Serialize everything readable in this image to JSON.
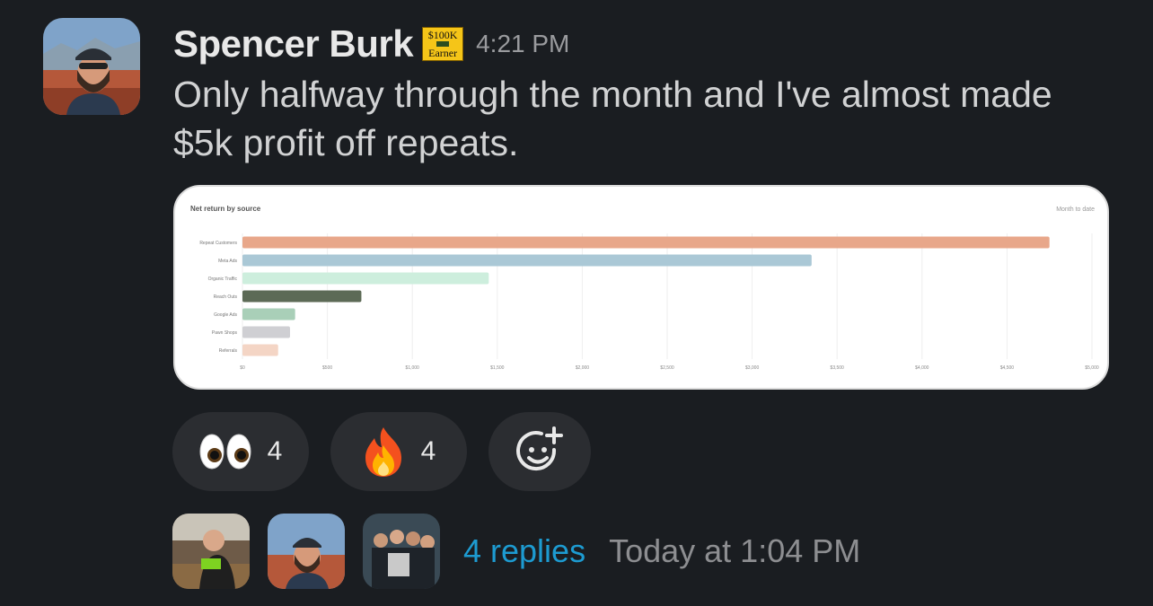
{
  "message": {
    "author": "Spencer Burk",
    "badge": {
      "top": "$100K",
      "bottom": "Earner"
    },
    "time": "4:21 PM",
    "text": "Only halfway through the month and I've almost made $5k profit off repeats."
  },
  "reactions": [
    {
      "emoji": "eyes-icon",
      "count": "4"
    },
    {
      "emoji": "fire-icon",
      "count": "4"
    }
  ],
  "thread": {
    "replies": "4 replies",
    "last_reply": "Today at 1:04 PM"
  },
  "chart_data": {
    "type": "bar",
    "orientation": "horizontal",
    "title": "Net return by source",
    "subtitle": "Month to date",
    "categories": [
      "Repeat Customers",
      "Meta Ads",
      "Organic Traffic",
      "Reach Outs",
      "Google Ads",
      "Pawn Shops",
      "Referrals"
    ],
    "values": [
      4750,
      3350,
      1450,
      700,
      310,
      280,
      210
    ],
    "colors": [
      "#e8a78a",
      "#aac8d6",
      "#cdeedd",
      "#5c6a56",
      "#a9cfb8",
      "#cfcfd3",
      "#f4d5c5"
    ],
    "xticks": [
      "$0",
      "$500",
      "$1,000",
      "$1,500",
      "$2,000",
      "$2,500",
      "$3,000",
      "$3,500",
      "$4,000",
      "$4,500",
      "$5,000"
    ],
    "xlim": [
      0,
      5000
    ],
    "grid": true
  }
}
